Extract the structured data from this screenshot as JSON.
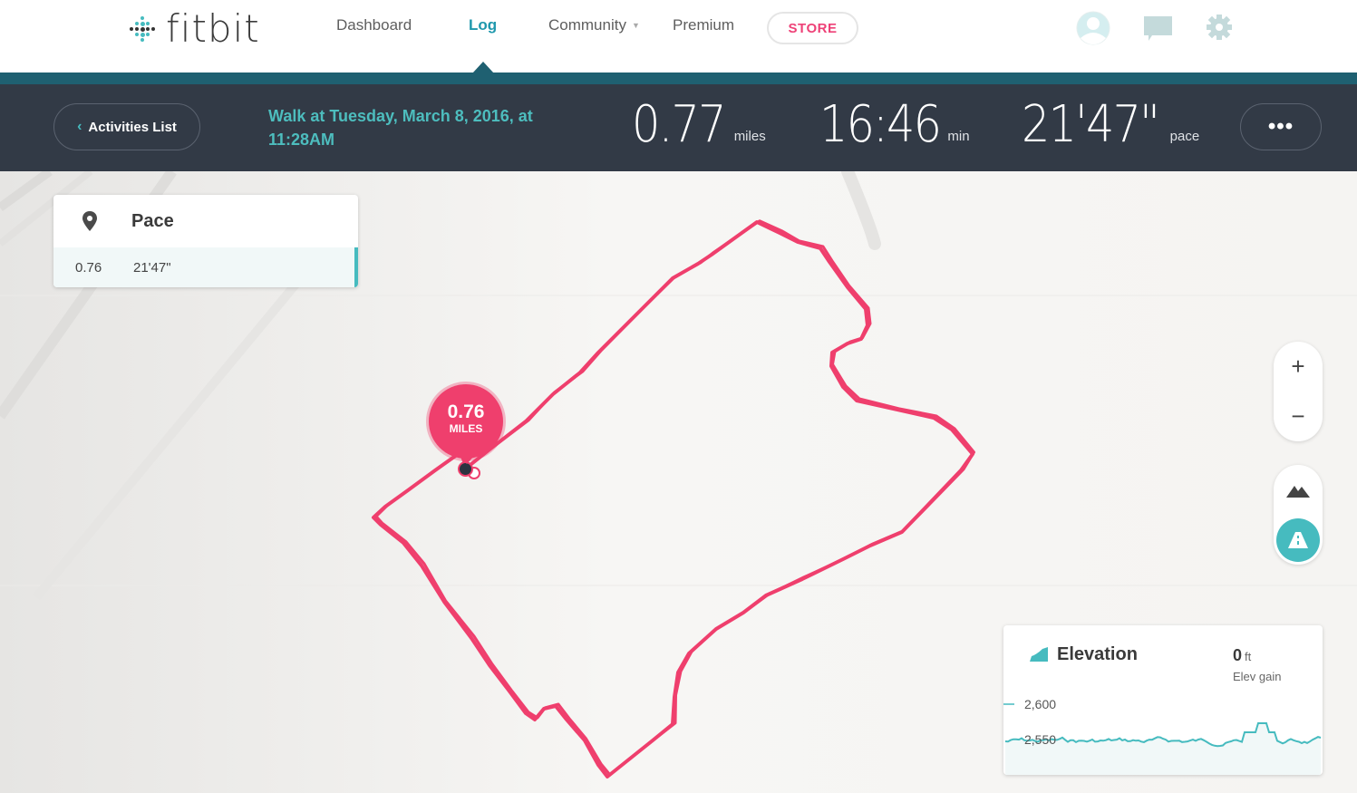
{
  "nav": {
    "logo_text": "fitbit",
    "items": [
      {
        "label": "Dashboard",
        "active": false
      },
      {
        "label": "Log",
        "active": true
      },
      {
        "label": "Community",
        "active": false,
        "has_dropdown": true
      },
      {
        "label": "Premium",
        "active": false
      }
    ],
    "store_label": "STORE",
    "icons": [
      "avatar-icon",
      "messages-icon",
      "settings-gear-icon"
    ]
  },
  "activity": {
    "back_label": "Activities List",
    "title": "Walk at Tuesday, March 8, 2016, at 11:28AM",
    "stats": [
      {
        "value": "0.77",
        "unit": "miles"
      },
      {
        "value": "16:46",
        "unit": "min"
      },
      {
        "value": "21'47\"",
        "unit": "pace"
      }
    ],
    "more_label": "•••"
  },
  "pace_panel": {
    "title": "Pace",
    "rows": [
      {
        "distance": "0.76",
        "pace": "21'47\""
      }
    ]
  },
  "map": {
    "marker_value": "0.76",
    "marker_unit": "MILES",
    "route_color": "#ef3f6d",
    "zoom_in_label": "+",
    "zoom_out_label": "−",
    "layers": [
      "terrain-icon",
      "road-icon"
    ],
    "active_layer": "road-icon"
  },
  "elevation": {
    "title": "Elevation",
    "gain_value": "0",
    "gain_unit": "ft",
    "gain_label": "Elev gain",
    "ticks": [
      "2,600",
      "2,550"
    ],
    "color": "#46bbbf"
  },
  "colors": {
    "brand_teal": "#46bbbf",
    "nav_active": "#1f98ad",
    "header_bg": "#323a46",
    "accent_bar": "#1f6071",
    "store_pink": "#ee4177"
  }
}
